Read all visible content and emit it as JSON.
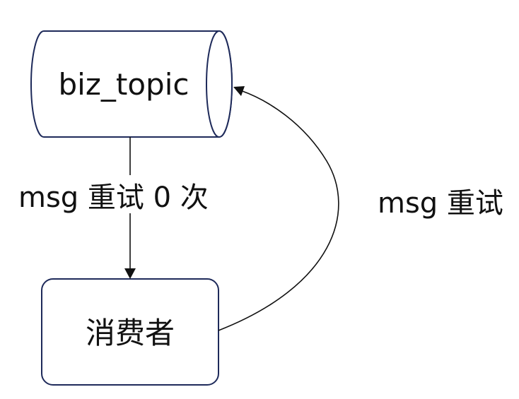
{
  "diagram": {
    "nodes": {
      "topic": {
        "label": "biz_topic",
        "shape": "cylinder"
      },
      "consumer": {
        "label": "消费者",
        "shape": "rounded-rectangle"
      }
    },
    "edges": {
      "deliver": {
        "from": "topic",
        "to": "consumer",
        "label": "msg 重试 0 次"
      },
      "retry": {
        "from": "consumer",
        "to": "topic",
        "label": "msg 重试"
      }
    }
  }
}
